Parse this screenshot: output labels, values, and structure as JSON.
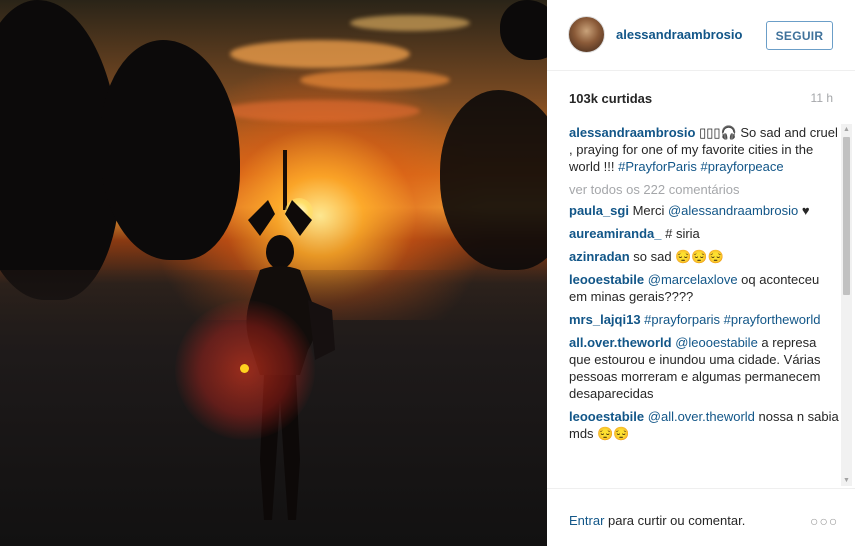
{
  "post": {
    "username": "alessandraambrosio",
    "follow_label": "SEGUIR",
    "likes": "103k curtidas",
    "time": "11 h"
  },
  "caption": {
    "user": "alessandraambrosio",
    "text": " ▯▯▯🎧 So sad and cruel , praying for one of my favorite cities in the world !!! ",
    "tags": [
      "#PrayforParis",
      "#prayforpeace"
    ]
  },
  "view_all": "ver todos os 222 comentários",
  "comments": [
    {
      "user": "paula_sgi",
      "text_before": " Merci ",
      "mention": "@alessandraambrosio",
      "text_after": " ♥"
    },
    {
      "user": "aureamiranda_",
      "text_before": " # siria",
      "mention": "",
      "text_after": ""
    },
    {
      "user": "azinradan",
      "text_before": " so sad 😔😔😔",
      "mention": "",
      "text_after": ""
    },
    {
      "user": "leooestabile",
      "text_before": " ",
      "mention": "@marcelaxlove",
      "text_after": " oq aconteceu em minas gerais????"
    },
    {
      "user": "mrs_lajqi13",
      "text_before": " ",
      "mention": "#prayforparis #prayfortheworld",
      "text_after": ""
    },
    {
      "user": "all.over.theworld",
      "text_before": " ",
      "mention": "@leooestabile",
      "text_after": " a represa que estourou e inundou uma cidade. Várias pessoas morreram e algumas permanecem desaparecidas"
    },
    {
      "user": "leooestabile",
      "text_before": " ",
      "mention": "@all.over.theworld",
      "text_after": " nossa n sabia mds 😔😔"
    }
  ],
  "footer": {
    "login_label": "Entrar",
    "rest_label": " para curtir ou comentar.",
    "more_label": "○○○"
  },
  "icons": {
    "scroll_up": "▲",
    "scroll_down": "▼"
  }
}
